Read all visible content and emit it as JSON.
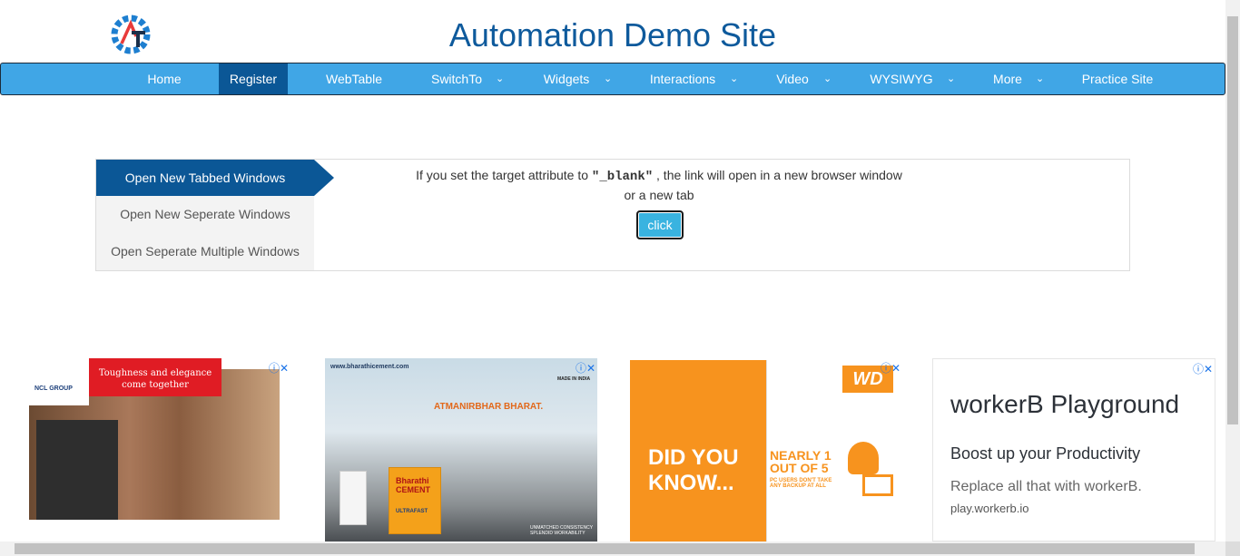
{
  "header": {
    "title": "Automation Demo Site"
  },
  "nav": {
    "items": [
      {
        "label": "Home"
      },
      {
        "label": "Register"
      },
      {
        "label": "WebTable"
      },
      {
        "label": "SwitchTo"
      },
      {
        "label": "Widgets"
      },
      {
        "label": "Interactions"
      },
      {
        "label": "Video"
      },
      {
        "label": "WYSIWYG"
      },
      {
        "label": "More"
      },
      {
        "label": "Practice Site"
      }
    ],
    "active": "Register",
    "colors": {
      "bar": "#40a6e6",
      "active": "#0b5796"
    }
  },
  "tabs": [
    {
      "label": "Open New Tabbed Windows"
    },
    {
      "label": "Open New Seperate Windows"
    },
    {
      "label": "Open Seperate Multiple Windows"
    }
  ],
  "content": {
    "msg_prefix": "If you set the target attribute to ",
    "msg_code": "\"_blank\"",
    "msg_suffix": " , the link will open in a new browser window or a new tab",
    "button_label": "click"
  },
  "ads": {
    "ad1": {
      "brand": "NCL GROUP",
      "headline": "Toughness and elegance come together"
    },
    "ad2": {
      "url": "www.bharathicement.com",
      "headline": "ATMANIRBHAR BHARAT.",
      "made": "MADE IN INDIA",
      "product": "Bharathi CEMENT",
      "sub": "ULTRAFAST",
      "tagline": "UNMATCHED CONSISTENCY SPLENDID WORKABILITY"
    },
    "ad3": {
      "logo": "WD",
      "headline": "DID YOU KNOW...",
      "stat": "NEARLY 1 OUT OF 5",
      "stat_sub": "PC USERS DON'T TAKE ANY BACKUP AT ALL"
    },
    "ad4": {
      "title": "workerB Playground",
      "subtitle": "Boost up your Productivity",
      "desc": "Replace all that with workerB.",
      "url": "play.workerb.io"
    }
  }
}
